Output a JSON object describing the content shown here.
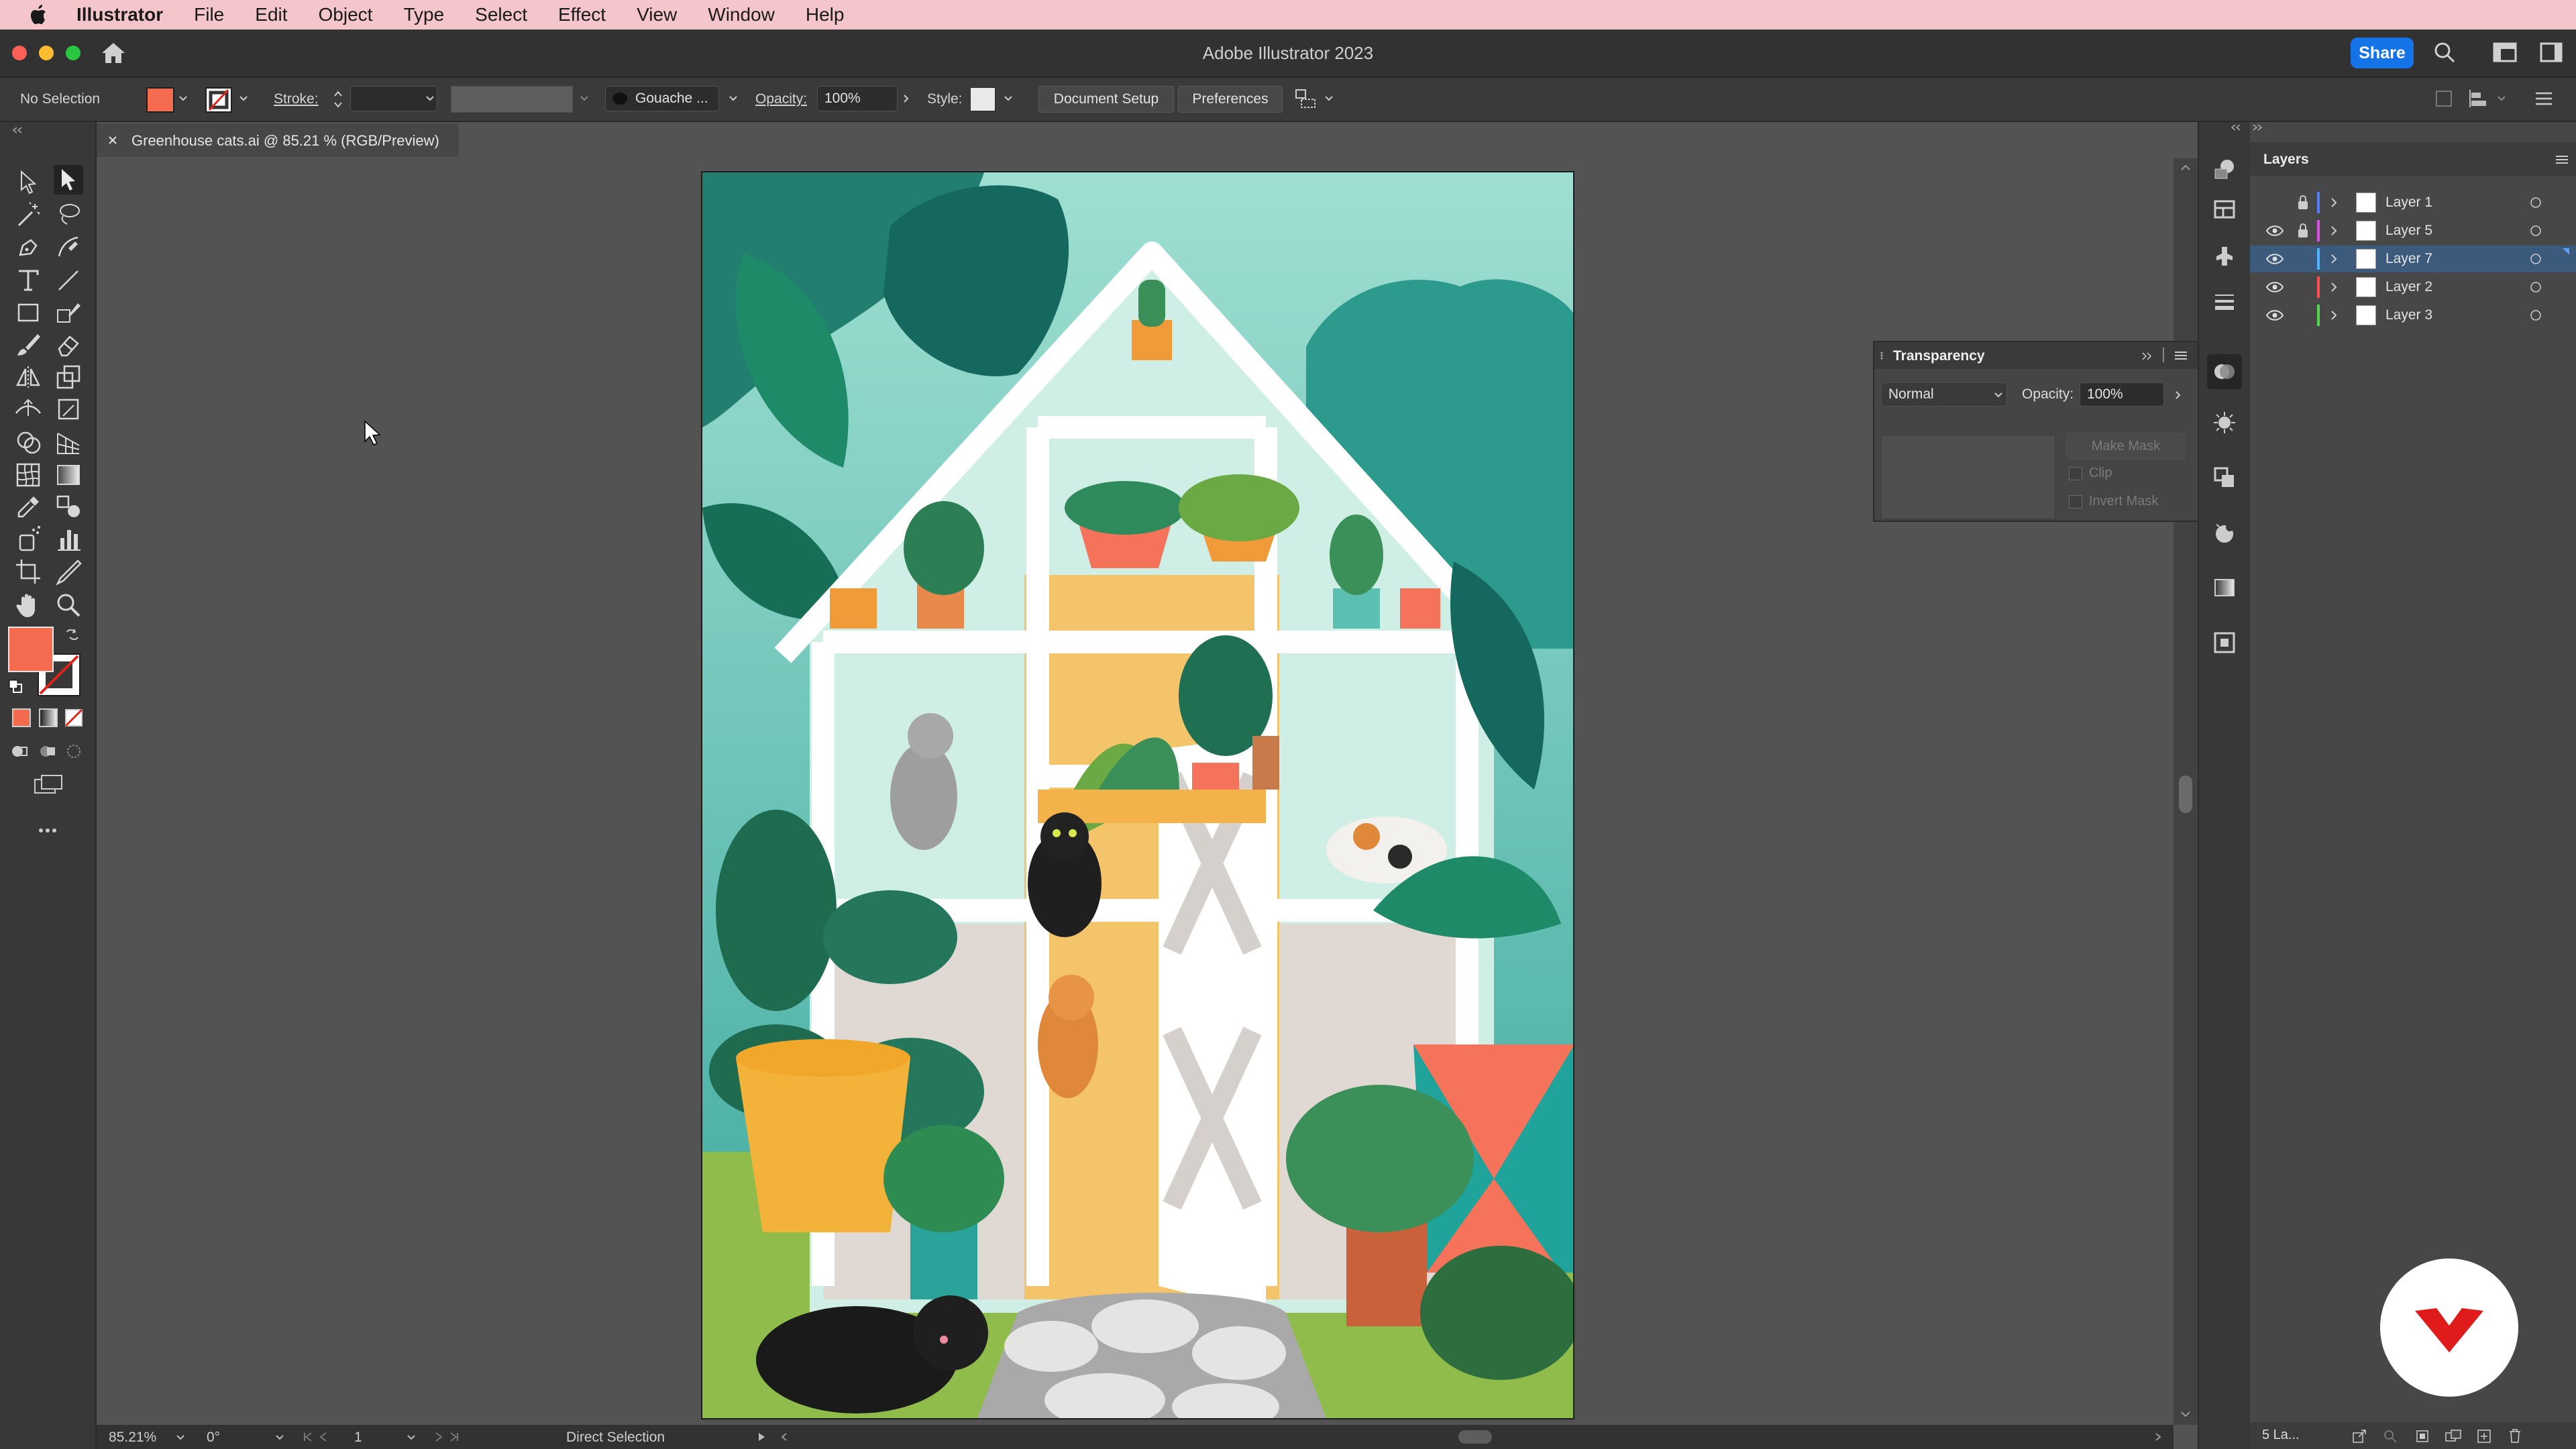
{
  "menubar": {
    "app_name": "Illustrator",
    "items": [
      "File",
      "Edit",
      "Object",
      "Type",
      "Select",
      "Effect",
      "View",
      "Window",
      "Help"
    ]
  },
  "titlebar": {
    "title": "Adobe Illustrator 2023",
    "share_label": "Share"
  },
  "control": {
    "selection": "No Selection",
    "stroke_label": "Stroke:",
    "brush": "Gouache ...",
    "opacity_label": "Opacity:",
    "opacity_value": "100%",
    "style_label": "Style:",
    "document_setup": "Document Setup",
    "preferences": "Preferences"
  },
  "colors": {
    "fill": "#f46b4f",
    "accent": "#1473e6",
    "selected_row": "#3c5a7c"
  },
  "document": {
    "tab_title": "Greenhouse cats.ai @ 85.21 % (RGB/Preview)"
  },
  "status": {
    "zoom": "85.21%",
    "rotation": "0°",
    "artboard_number": "1",
    "tool_name": "Direct Selection"
  },
  "transparency": {
    "title": "Transparency",
    "blend_mode": "Normal",
    "opacity_label": "Opacity:",
    "opacity_value": "100%",
    "make_mask": "Make Mask",
    "clip": "Clip",
    "invert_mask": "Invert Mask"
  },
  "layers": {
    "title": "Layers",
    "rows": [
      {
        "name": "Layer 1",
        "color": "#4f7fff",
        "visible": false,
        "locked": true,
        "selected": false
      },
      {
        "name": "Layer 5",
        "color": "#d94fe0",
        "visible": true,
        "locked": true,
        "selected": false
      },
      {
        "name": "Layer 7",
        "color": "#4fb3ff",
        "visible": true,
        "locked": false,
        "selected": true
      },
      {
        "name": "Layer 2",
        "color": "#ff4f4f",
        "visible": true,
        "locked": false,
        "selected": false
      },
      {
        "name": "Layer 3",
        "color": "#4fd94f",
        "visible": true,
        "locked": false,
        "selected": false
      }
    ],
    "footer_count": "5 La..."
  }
}
